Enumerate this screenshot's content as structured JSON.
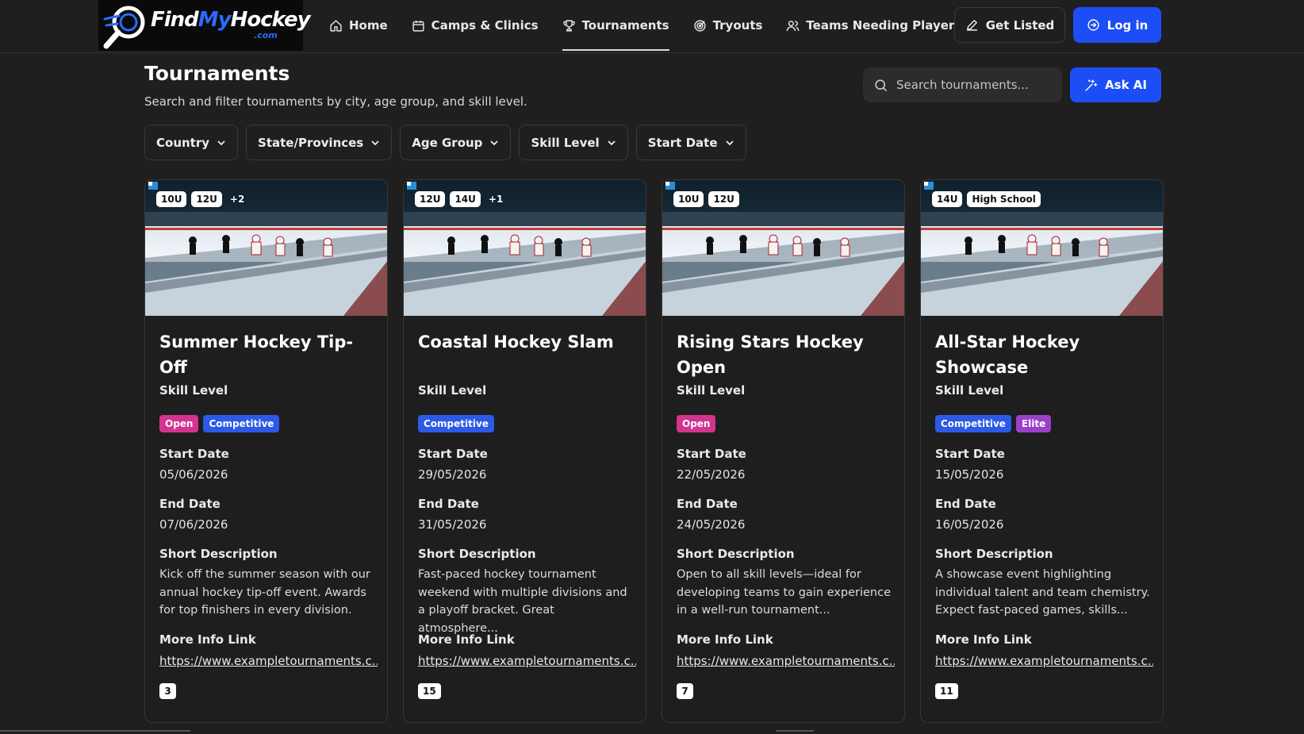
{
  "brand": {
    "find": "Find",
    "my": "My",
    "hockey": "Hockey",
    "sub": ".com"
  },
  "nav": [
    {
      "label": "Home",
      "icon": "home-icon"
    },
    {
      "label": "Camps & Clinics",
      "icon": "calendar-icon"
    },
    {
      "label": "Tournaments",
      "icon": "trophy-icon",
      "active": true
    },
    {
      "label": "Tryouts",
      "icon": "target-icon"
    },
    {
      "label": "Teams Needing Players",
      "icon": "users-icon"
    }
  ],
  "actions": {
    "get_listed": "Get Listed",
    "login": "Log in"
  },
  "header": {
    "title": "Tournaments",
    "subtitle": "Search and filter tournaments by city, age group, and skill level.",
    "search_placeholder": "Search tournaments...",
    "ask_ai": "Ask AI"
  },
  "filters": [
    "Country",
    "State/Provinces",
    "Age Group",
    "Skill Level",
    "Start Date"
  ],
  "labels": {
    "skill": "Skill Level",
    "start": "Start Date",
    "end": "End Date",
    "desc": "Short Description",
    "link": "More Info Link"
  },
  "cards": [
    {
      "tags": [
        "10U",
        "12U"
      ],
      "more": "+2",
      "title": "Summer Hockey Tip-Off",
      "skills": [
        {
          "label": "Open",
          "kind": "open"
        },
        {
          "label": "Competitive",
          "kind": "competitive"
        }
      ],
      "start": "05/06/2026",
      "end": "07/06/2026",
      "desc": "Kick off the summer season with our annual hockey tip-off event. Awards for top finishers in every division.",
      "link": "https://www.exampletournaments.c...",
      "count": "3"
    },
    {
      "tags": [
        "12U",
        "14U"
      ],
      "more": "+1",
      "title": "Coastal Hockey Slam",
      "skills": [
        {
          "label": "Competitive",
          "kind": "competitive"
        }
      ],
      "start": "29/05/2026",
      "end": "31/05/2026",
      "desc": "Fast-paced hockey tournament weekend with multiple divisions and a playoff bracket. Great atmosphere...",
      "link": "https://www.exampletournaments.c...",
      "count": "15"
    },
    {
      "tags": [
        "10U",
        "12U"
      ],
      "more": "",
      "title": "Rising Stars Hockey Open",
      "skills": [
        {
          "label": "Open",
          "kind": "open"
        }
      ],
      "start": "22/05/2026",
      "end": "24/05/2026",
      "desc": "Open to all skill levels—ideal for developing teams to gain experience in a well-run tournament...",
      "link": "https://www.exampletournaments.c...",
      "count": "7"
    },
    {
      "tags": [
        "14U",
        "High School"
      ],
      "more": "",
      "title": "All-Star Hockey Showcase",
      "skills": [
        {
          "label": "Competitive",
          "kind": "competitive"
        },
        {
          "label": "Elite",
          "kind": "elite"
        }
      ],
      "start": "15/05/2026",
      "end": "16/05/2026",
      "desc": "A showcase event highlighting individual talent and team chemistry. Expect fast-paced games, skills...",
      "link": "https://www.exampletournaments.c...",
      "count": "11"
    }
  ],
  "colors": {
    "accent": "#1d4ef5",
    "open": "#d2348f",
    "competitive": "#2c5ae6",
    "elite": "#9b3fc9"
  }
}
